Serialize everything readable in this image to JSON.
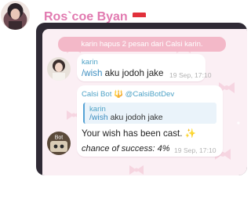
{
  "header": {
    "title": "Ros`coe Byan",
    "flag_icon": "indonesia-flag-icon"
  },
  "colors": {
    "title": "#e17ab0",
    "panel": "#2f2a35",
    "chat_background": "#fbeff4",
    "service_pill": "#f3b8c8",
    "link": "#3d8ec0",
    "sender_name": "#4fa3c7"
  },
  "chat": {
    "service_message": "karin hapus 2 pesan dari Calsi karin.",
    "messages": [
      {
        "sender": "karin",
        "command": "/wish",
        "text": "aku jodoh jake",
        "time": "19 Sep, 17:10"
      },
      {
        "sender": "Calsi Bot 🔱 @CalsiBotDev",
        "reply_sender": "karin",
        "reply_command": "/wish",
        "reply_text": "aku jodoh jake",
        "text": "Your wish has been cast. ✨",
        "chance_text": "chance of success: 4%",
        "time": "19 Sep, 17:10",
        "avatar_label": "Bot"
      }
    ]
  }
}
